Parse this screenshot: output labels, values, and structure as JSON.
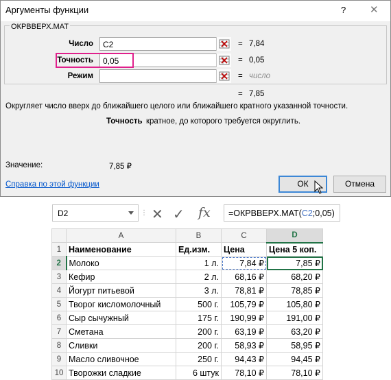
{
  "dialog": {
    "title": "Аргументы функции",
    "help_symbol": "?",
    "close_symbol": "✕",
    "function_name": "ОКРВВЕРХ.МАТ",
    "args": [
      {
        "label": "Число",
        "value": "C2",
        "eq": "=",
        "result": "7,84"
      },
      {
        "label": "Точность",
        "value": "0,05",
        "eq": "=",
        "result": "0,05"
      },
      {
        "label": "Режим",
        "value": "",
        "eq": "=",
        "result": "число"
      }
    ],
    "total_eq": "=",
    "total_result": "7,85",
    "description": "Округляет число вверх до ближайшего целого или ближайшего кратного указанной точности.",
    "arg_desc_name": "Точность",
    "arg_desc_text": "кратное, до которого требуется округлить.",
    "value_label": "Значение:",
    "value": "7,85 ₽",
    "help_link": "Справка по этой функции",
    "ok": "ОК",
    "cancel": "Отмена"
  },
  "sheet": {
    "name_box": "D2",
    "fx": "fx",
    "formula_pre": "=ОКРВВЕРХ.МАТ(",
    "formula_ref": "C2",
    "formula_post": ";0,05)",
    "columns": [
      "A",
      "B",
      "C",
      "D"
    ],
    "rows": [
      {
        "n": "1",
        "a": "Наименование",
        "b": "Ед.изм.",
        "c": "Цена",
        "d": "Цена 5 коп."
      },
      {
        "n": "2",
        "a": "Молоко",
        "b": "1 л.",
        "c": "7,84 ₽",
        "d": "7,85 ₽"
      },
      {
        "n": "3",
        "a": "Кефир",
        "b": "2 л.",
        "c": "68,16 ₽",
        "d": "68,20 ₽"
      },
      {
        "n": "4",
        "a": "Йогурт питьевой",
        "b": "3 л.",
        "c": "78,81 ₽",
        "d": "78,85 ₽"
      },
      {
        "n": "5",
        "a": "Творог кисломолочный",
        "b": "500 г.",
        "c": "105,79 ₽",
        "d": "105,80 ₽"
      },
      {
        "n": "6",
        "a": "Сыр сычужный",
        "b": "175 г.",
        "c": "190,99 ₽",
        "d": "191,00 ₽"
      },
      {
        "n": "7",
        "a": "Сметана",
        "b": "200 г.",
        "c": "63,19 ₽",
        "d": "63,20 ₽"
      },
      {
        "n": "8",
        "a": "Сливки",
        "b": "200 г.",
        "c": "58,93 ₽",
        "d": "58,95 ₽"
      },
      {
        "n": "9",
        "a": "Масло сливочное",
        "b": "250 г.",
        "c": "94,43 ₽",
        "d": "94,45 ₽"
      },
      {
        "n": "10",
        "a": "Творожки сладкие",
        "b": "6 штук",
        "c": "78,10 ₽",
        "d": "78,10 ₽"
      }
    ]
  }
}
